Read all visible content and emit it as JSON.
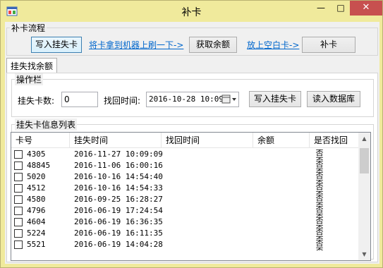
{
  "window": {
    "title": "补卡",
    "minimize_symbol": "—",
    "maximize_symbol": "□",
    "close_symbol": "✕"
  },
  "process_group": {
    "title": "补卡流程",
    "write_loss_card_button": "写入挂失卡",
    "link_swipe_card": "将卡拿到机器上刷一下->",
    "get_balance_button": "获取余额",
    "link_put_blank_card": "放上空白卡->",
    "reissue_button": "补卡"
  },
  "tabs": [
    {
      "label": "挂失找余额"
    }
  ],
  "operation_group": {
    "title": "操作栏",
    "loss_count_label": "挂失卡数:",
    "loss_count_value": "0",
    "recover_time_label": "找回时间:",
    "recover_time_value": "2016-10-28 10:09",
    "write_button": "写入挂失卡",
    "read_db_button": "读入数据库"
  },
  "list_group": {
    "title": "挂失卡信息列表",
    "columns": [
      "卡号",
      "挂失时间",
      "找回时间",
      "余额",
      "是否找回"
    ],
    "rows": [
      {
        "card": "4305",
        "loss_time": "2016-11-27 10:09:09",
        "recover_time": "",
        "balance": "",
        "found": "否否"
      },
      {
        "card": "48845",
        "loss_time": "2016-11-06 16:00:16",
        "recover_time": "",
        "balance": "",
        "found": "否否"
      },
      {
        "card": "5020",
        "loss_time": "2016-10-16 14:54:40",
        "recover_time": "",
        "balance": "",
        "found": "否否"
      },
      {
        "card": "4512",
        "loss_time": "2016-10-16 14:54:33",
        "recover_time": "",
        "balance": "",
        "found": "否否"
      },
      {
        "card": "4580",
        "loss_time": "2016-09-25 16:28:27",
        "recover_time": "",
        "balance": "",
        "found": "否否"
      },
      {
        "card": "4796",
        "loss_time": "2016-06-19 17:24:54",
        "recover_time": "",
        "balance": "",
        "found": "否否"
      },
      {
        "card": "4604",
        "loss_time": "2016-06-19 16:36:35",
        "recover_time": "",
        "balance": "",
        "found": "否否"
      },
      {
        "card": "5224",
        "loss_time": "2016-06-19 16:11:35",
        "recover_time": "",
        "balance": "",
        "found": "否否"
      },
      {
        "card": "5521",
        "loss_time": "2016-06-19 14:04:28",
        "recover_time": "",
        "balance": "",
        "found": "否否"
      }
    ]
  },
  "icons": {
    "app": "app-window-icon",
    "calendar": "calendar-dropdown-icon"
  }
}
